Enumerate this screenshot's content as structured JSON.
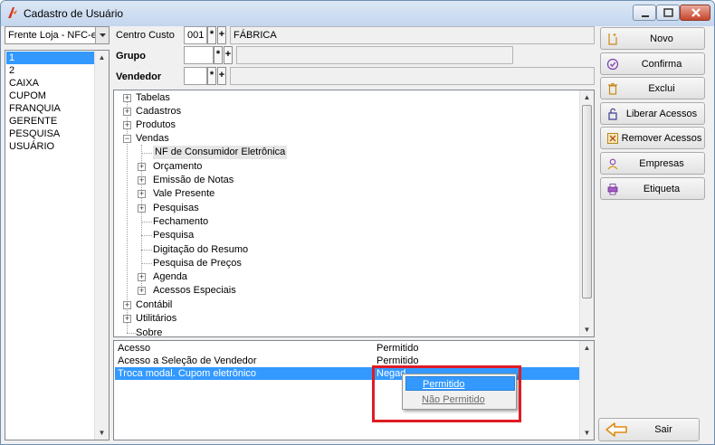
{
  "window": {
    "title": "Cadastro de Usuário"
  },
  "store_select": {
    "value": "Frente Loja - NFC-e"
  },
  "users": [
    "1",
    "2",
    "CAIXA",
    "CUPOM",
    "FRANQUIA",
    "GERENTE",
    "PESQUISA",
    "USUÁRIO"
  ],
  "selected_user_index": 0,
  "form": {
    "centro_custo": {
      "label": "Centro Custo",
      "code": "001",
      "name": "FÁBRICA"
    },
    "grupo": {
      "label": "Grupo",
      "code": "",
      "name": ""
    },
    "vendedor": {
      "label": "Vendedor",
      "code": "",
      "name": ""
    },
    "asterisk_label": "*",
    "plus_label": "+"
  },
  "tree": {
    "root_nodes": [
      "Tabelas",
      "Cadastros",
      "Produtos",
      "Vendas",
      "Contábil",
      "Utilitários",
      "Sobre"
    ],
    "vendas_children": [
      "NF de Consumidor Eletrônica",
      "Orçamento",
      "Emissão de Notas",
      "Vale Presente",
      "Pesquisas",
      "Fechamento",
      "Pesquisa",
      "Digitação do Resumo",
      "Pesquisa de Preços",
      "Agenda",
      "Acessos Especiais"
    ],
    "selected": "NF de Consumidor Eletrônica",
    "expand_symbol": "+",
    "collapse_symbol": "−"
  },
  "permissions": [
    {
      "access": "Acesso",
      "status": "Permitido"
    },
    {
      "access": "Acesso a Seleção de Vendedor",
      "status": "Permitido"
    },
    {
      "access": "Troca modal. Cupom eletrônico",
      "status": "Negad"
    }
  ],
  "context_menu": {
    "items": [
      "Permitido",
      "Não Permitido"
    ]
  },
  "actions": {
    "novo": "Novo",
    "confirma": "Confirma",
    "exclui": "Exclui",
    "liberar": "Liberar Acessos",
    "remover": "Remover Acessos",
    "empresas": "Empresas",
    "etiqueta": "Etiqueta",
    "sair": "Sair"
  },
  "scroll": {
    "up": "▲",
    "down": "▼"
  },
  "colors": {
    "selection": "#3399ff",
    "highlight_border": "#e01b24"
  }
}
